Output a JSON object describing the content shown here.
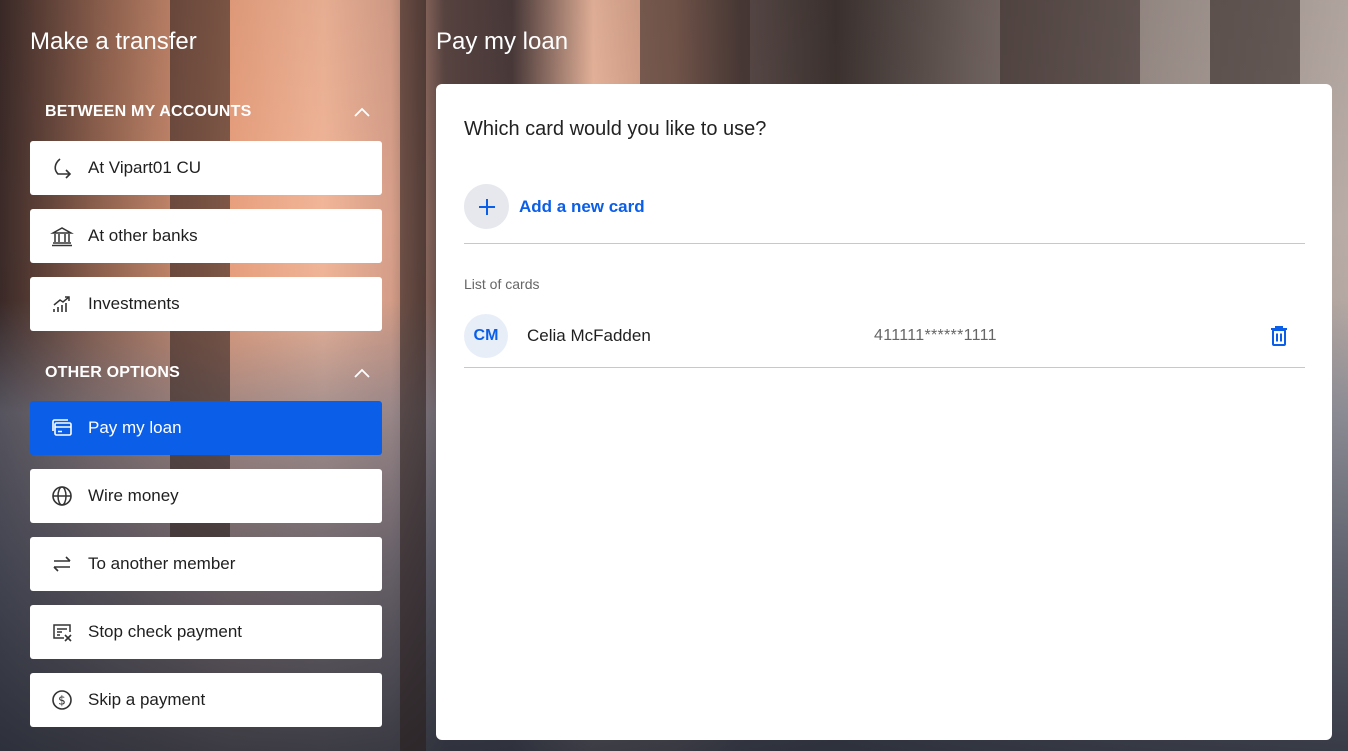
{
  "left": {
    "title": "Make a transfer",
    "section_between": "BETWEEN MY ACCOUNTS",
    "section_other": "OTHER OPTIONS",
    "between_items": [
      {
        "label": "At Vipart01 CU",
        "icon": "redirect-arrow-icon"
      },
      {
        "label": "At other banks",
        "icon": "bank-icon"
      },
      {
        "label": "Investments",
        "icon": "chart-growth-icon"
      }
    ],
    "other_items": [
      {
        "label": "Pay my loan",
        "icon": "card-payment-icon",
        "active": true
      },
      {
        "label": "Wire money",
        "icon": "globe-icon"
      },
      {
        "label": "To another member",
        "icon": "swap-arrows-icon"
      },
      {
        "label": "Stop check payment",
        "icon": "stop-check-icon"
      },
      {
        "label": "Skip a payment",
        "icon": "dollar-circle-icon"
      }
    ]
  },
  "main": {
    "title": "Pay my loan",
    "question": "Which card would you like to use?",
    "add_card_label": "Add a new card",
    "list_label": "List of cards",
    "cards": [
      {
        "initials": "CM",
        "name": "Celia McFadden",
        "number": "411111******1111"
      }
    ]
  },
  "colors": {
    "accent": "#0b5ee8",
    "panel_bg": "#ffffff",
    "text": "#1f1f1f"
  }
}
